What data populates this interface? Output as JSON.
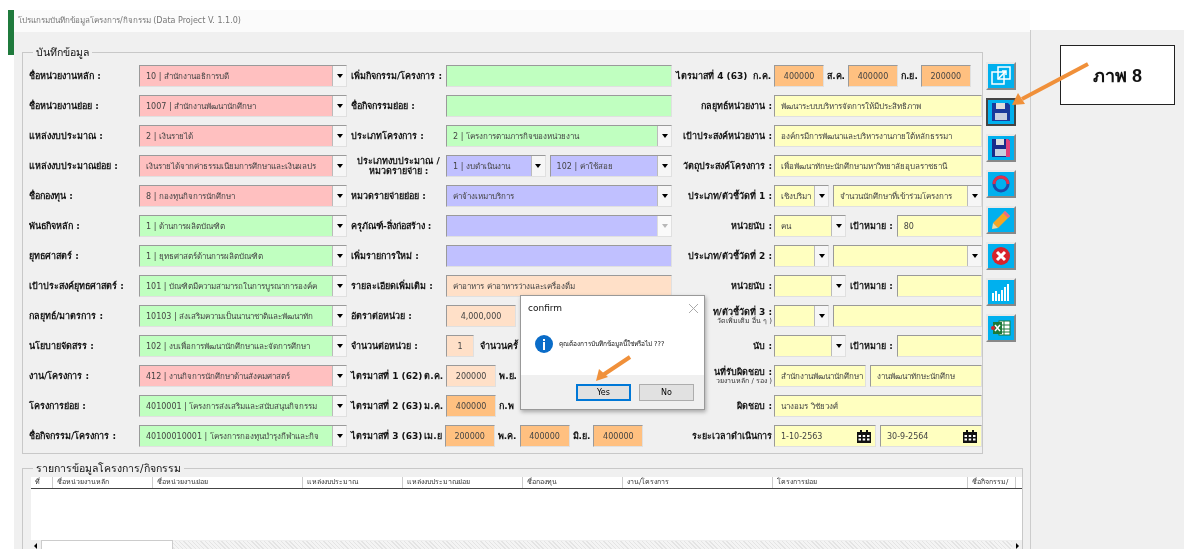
{
  "window": {
    "title": "โปรแกรมบันทึกข้อมูลโครงการ/กิจกรรม (Data Project V. 1.1.0)"
  },
  "form": {
    "title": "บันทึกข้อมูล",
    "columns": [
      {
        "rows": [
          {
            "kind": "wide",
            "label": "ชื่อหน่วยงานหลัก :",
            "fields": [
              {
                "kind": "select",
                "value": "10 | สำนักงานอธิการบดี",
                "color": "#ffc0c0",
                "disabled": false
              }
            ]
          },
          {
            "kind": "wide",
            "label": "ชื่อหน่วยงานย่อย :",
            "fields": [
              {
                "kind": "select",
                "value": "1007 | สำนักงานพัฒนานักศึกษา",
                "color": "#ffc0c0",
                "disabled": false
              }
            ]
          },
          {
            "kind": "wide",
            "label": "แหล่งงบประมาณ :",
            "fields": [
              {
                "kind": "select",
                "value": "2 | เงินรายได้",
                "color": "#ffc0c0",
                "disabled": false
              }
            ]
          },
          {
            "kind": "wide",
            "label": "แหล่งงบประมาณย่อย :",
            "fields": [
              {
                "kind": "select",
                "value": "เงินรายได้จากค่าธรรมเนียมการศึกษาและเงินผลปร",
                "color": "#ffc0c0",
                "disabled": false
              }
            ]
          },
          {
            "kind": "wide",
            "label": "ชื่อกองทุน :",
            "fields": [
              {
                "kind": "select",
                "value": "8 | กองทุนกิจการนักศึกษา",
                "color": "#ffc0c0",
                "disabled": false
              }
            ]
          },
          {
            "kind": "wide",
            "label": "พันธกิจหลัก :",
            "fields": [
              {
                "kind": "select",
                "value": "1 | ด้านการผลิตบัณฑิต",
                "color": "#c0ffc0",
                "disabled": false
              }
            ]
          },
          {
            "kind": "wide",
            "label": "ยุทธศาสตร์ :",
            "fields": [
              {
                "kind": "select",
                "value": "1 | ยุทธศาสตร์ด้านการผลิตบัณฑิต",
                "color": "#c0ffc0",
                "disabled": false
              }
            ]
          },
          {
            "kind": "wide",
            "label": "เป้าประสงค์ยุทธศาสตร์ :",
            "fields": [
              {
                "kind": "select",
                "value": "101 | บัณฑิตมีความสามารถในการบูรณาการองค์ค",
                "color": "#c0ffc0",
                "disabled": false
              }
            ]
          },
          {
            "kind": "wide",
            "label": "กลยุทธ์/มาตรการ :",
            "fields": [
              {
                "kind": "select",
                "value": "10103 | ส่งเสริมความเป็นนานาชาติและพัฒนาทัก",
                "color": "#c0ffc0",
                "disabled": false
              }
            ]
          },
          {
            "kind": "wide",
            "label": "นโยบายจัดสรร :",
            "fields": [
              {
                "kind": "select",
                "value": "102 | งบเพื่อการพัฒนานักศึกษาและจัดการศึกษา",
                "color": "#c0ffc0",
                "disabled": false
              }
            ]
          },
          {
            "kind": "wide",
            "label": "งาน/โครงการ :",
            "fields": [
              {
                "kind": "select",
                "value": "412 | งานกิจการนักศึกษาด้านสังคมศาสตร์",
                "color": "#ffc0c0",
                "disabled": false
              }
            ]
          },
          {
            "kind": "wide",
            "label": "โครงการย่อย :",
            "fields": [
              {
                "kind": "select",
                "value": "4010001 | โครงการส่งเสริมและสนับสนุนกิจกรรม",
                "color": "#c0ffc0",
                "disabled": false
              }
            ]
          },
          {
            "kind": "wide",
            "label": "ชื่อกิจกรรม/โครงการ :",
            "fields": [
              {
                "kind": "select",
                "value": "40100010001 | โครงการกองทุนบำรุงกีฬาและกิจ",
                "color": "#c0ffc0",
                "disabled": false
              }
            ]
          }
        ]
      },
      {
        "rows": [
          {
            "kind": "wide",
            "label": "เพิ่มกิจกรรม/โครงการ :",
            "fields": [
              {
                "kind": "text",
                "color": "#c0ffc0"
              }
            ]
          },
          {
            "kind": "wide",
            "label": "ชื่อกิจกรรมย่อย :",
            "fields": [
              {
                "kind": "text",
                "color": "#c0ffc0"
              }
            ]
          },
          {
            "kind": "wide",
            "label": "ประเภทโครงการ :",
            "fields": [
              {
                "kind": "select",
                "value": "2 | โครงการตามภารกิจของหน่วยงาน",
                "color": "#c0ffc0",
                "disabled": false
              }
            ]
          },
          {
            "kind": "pair",
            "label": "ประเภทงบประมาณ / หมวดรายจ่าย :",
            "fields": [
              {
                "kind": "select",
                "value": "1 | งบดำเนินงาน",
                "color": "#c0c0ff",
                "disabled": false
              },
              {
                "kind": "select",
                "value": "102 | ค่าใช้สอย",
                "color": "#c0c0ff",
                "disabled": false
              }
            ]
          },
          {
            "kind": "wide",
            "label": "หมวดรายจ่ายย่อย :",
            "fields": [
              {
                "kind": "select",
                "value": "ค่าจ้างเหมาบริการ",
                "color": "#c0c0ff",
                "disabled": false
              }
            ]
          },
          {
            "kind": "wide",
            "label": "ครุภัณฑ์-สิ่งก่อสร้าง :",
            "fields": [
              {
                "kind": "select",
                "color": "#c0c0ff",
                "disabled": true
              }
            ]
          },
          {
            "kind": "wide",
            "label": "เพิ่มรายการใหม่ :",
            "fields": [
              {
                "kind": "text",
                "color": "#c0c0ff"
              }
            ]
          },
          {
            "kind": "wide",
            "label": "รายละเอียดเพิ่มเติม :",
            "fields": [
              {
                "kind": "text",
                "value": "ค่าอาหาร ค่าอาหารว่างและเครื่องดื่ม",
                "color": "#ffe0c8"
              }
            ]
          },
          {
            "kind": "short",
            "label": "อัตราต่อหน่วย :",
            "fields": [
              {
                "kind": "text",
                "value": "4,000,000",
                "color": "#ffe0c8"
              }
            ]
          },
          {
            "kind": "count",
            "label": "จำนวนต่อหน่วย :",
            "fields": [
              {
                "kind": "text",
                "value": "1",
                "color": "#ffe0c8"
              },
              {
                "kind": "caption",
                "text": "จำนวนครั้"
              }
            ]
          },
          {
            "kind": "quarter",
            "label": "ไตรมาสที่ 1 (62)",
            "fields": [
              {
                "kind": "caption",
                "text": "ต.ค."
              },
              {
                "kind": "text",
                "value": "200000",
                "color": "#ffe0c8"
              },
              {
                "kind": "caption",
                "text": "พ.ย."
              }
            ]
          },
          {
            "kind": "quarter",
            "label": "ไตรมาสที่ 2 (63)",
            "fields": [
              {
                "kind": "caption",
                "text": "ม.ค."
              },
              {
                "kind": "text",
                "value": "400000",
                "color": "#ffc080"
              },
              {
                "kind": "caption",
                "text": "ก.พ"
              }
            ]
          },
          {
            "kind": "quarter",
            "label": "ไตรมาสที่ 3 (63)",
            "fields": [
              {
                "kind": "caption",
                "text": "เม.ย"
              },
              {
                "kind": "text",
                "value": "200000",
                "color": "#ffc080"
              },
              {
                "kind": "caption",
                "text": "พ.ค."
              },
              {
                "kind": "text",
                "value": "400000",
                "color": "#ffc080"
              },
              {
                "kind": "caption",
                "text": "มิ.ย."
              },
              {
                "kind": "text",
                "value": "400000",
                "color": "#ffc080"
              }
            ]
          }
        ]
      },
      {
        "rows": [
          {
            "kind": "quarter",
            "label": "ไตรมาสที่ 4 (63)",
            "fields": [
              {
                "kind": "caption",
                "text": "ก.ค."
              },
              {
                "kind": "text",
                "value": "400000",
                "color": "#ffc080"
              },
              {
                "kind": "caption",
                "text": "ส.ค."
              },
              {
                "kind": "text",
                "value": "400000",
                "color": "#ffc080"
              },
              {
                "kind": "caption",
                "text": "ก.ย."
              },
              {
                "kind": "text",
                "value": "200000",
                "color": "#ffc080"
              }
            ]
          },
          {
            "kind": "wide",
            "label": "กลยุทธ์หน่วยงาน :",
            "fields": [
              {
                "kind": "text",
                "value": "พัฒนาระบบบริหารจัดการให้มีประสิทธิภาพ",
                "color": "#ffffc0"
              }
            ]
          },
          {
            "kind": "wide",
            "label": "เป้าประสงค์หน่วยงาน :",
            "fields": [
              {
                "kind": "text",
                "value": "องค์กรมีการพัฒนาและบริหารงานภายใต้หลักธรรมา",
                "color": "#ffffc0"
              }
            ]
          },
          {
            "kind": "wide",
            "label": "วัตถุประสงค์โครงการ :",
            "fields": [
              {
                "kind": "text",
                "value": "เพื่อพัฒนาทักษะนักศึกษามหาวิทยาลัยอุบลราชธานี",
                "color": "#ffffc0"
              }
            ]
          },
          {
            "kind": "indicator",
            "label": "ประเภท/ตัวชี้วัดที่ 1 :",
            "fields": [
              {
                "kind": "select",
                "value": "เชิงปริมา",
                "color": "#ffffc0",
                "disabled": false
              },
              {
                "kind": "select",
                "value": "จำนวนนักศึกษาที่เข้าร่วมโครงการ",
                "color": "#ffffc0",
                "disabled": false
              }
            ]
          },
          {
            "kind": "unit",
            "label": "หน่วยนับ :",
            "fields": [
              {
                "kind": "select",
                "value": "คน",
                "color": "#ffffc0",
                "disabled": false
              },
              {
                "kind": "caption",
                "text": "เป้าหมาย :"
              },
              {
                "kind": "text",
                "value": "80",
                "color": "#ffffc0"
              }
            ]
          },
          {
            "kind": "indicator",
            "label": "ประเภท/ตัวชี้วัดที่ 2 :",
            "fields": [
              {
                "kind": "select",
                "color": "#ffffc0",
                "disabled": false
              },
              {
                "kind": "select",
                "color": "#ffffc0",
                "disabled": false
              }
            ]
          },
          {
            "kind": "unit",
            "label": "หน่วยนับ :",
            "fields": [
              {
                "kind": "select",
                "color": "#ffffc0",
                "disabled": false
              },
              {
                "kind": "caption",
                "text": "เป้าหมาย :"
              },
              {
                "kind": "text",
                "color": "#ffffc0"
              }
            ]
          },
          {
            "kind": "indicator",
            "label": "ท/ตัวชี้วัดที่ 3 :",
            "note": "วัดเพิ่มเติม อื่น ๆ )",
            "fields": [
              {
                "kind": "select",
                "color": "#ffffc0",
                "disabled": false
              },
              {
                "kind": "text",
                "color": "#ffffc0"
              }
            ]
          },
          {
            "kind": "unit",
            "label": "นับ :",
            "fields": [
              {
                "kind": "select",
                "color": "#ffffc0",
                "disabled": false
              },
              {
                "kind": "caption",
                "text": "เป้าหมาย :"
              },
              {
                "kind": "text",
                "color": "#ffffc0"
              }
            ]
          },
          {
            "kind": "pair",
            "label": "นที่รับผิดชอบ :",
            "note": "วยงานหลัก / รอง )",
            "fields": [
              {
                "kind": "text",
                "value": "สำนักงานพัฒนานักศึกษา",
                "color": "#ffffc0"
              },
              {
                "kind": "text",
                "value": "งานพัฒนาทักษะนักศึกษ",
                "color": "#ffffc0"
              }
            ]
          },
          {
            "kind": "wide",
            "label": "ผิดชอบ :",
            "fields": [
              {
                "kind": "text",
                "value": "นางอมร วิชัยวงศ์",
                "color": "#ffffc0"
              }
            ]
          },
          {
            "kind": "dates",
            "label": "ระยะเวลาดำเนินการ",
            "fields": [
              {
                "kind": "date",
                "value": "1-10-2563",
                "color": "#ffffc0"
              },
              {
                "kind": "date",
                "value": "30-9-2564",
                "color": "#ffffc0"
              }
            ]
          }
        ]
      }
    ]
  },
  "toolbar": [
    {
      "kind": "expand",
      "selected": false
    },
    {
      "kind": "save",
      "selected": true
    },
    {
      "kind": "save_as",
      "selected": false
    },
    {
      "kind": "refresh",
      "selected": false
    },
    {
      "kind": "edit",
      "selected": false
    },
    {
      "kind": "delete",
      "selected": false
    },
    {
      "kind": "chart",
      "selected": false
    },
    {
      "kind": "excel",
      "selected": false
    }
  ],
  "records": {
    "title": "รายการข้อมูลโครงการ/กิจกรรม",
    "columns": [
      "ที่",
      "ชื่อหน่วยงานหลัก",
      "ชื่อหน่วยงานย่อย",
      "แหล่งงบประมาณ",
      "แหล่งงบประมาณย่อย",
      "ชื่อกองทุน",
      "งาน/โครงการ",
      "โครงการย่อย",
      "ชื่อกิจกรรม/"
    ]
  },
  "dialog": {
    "title": "confirm",
    "message": "คุณต้องการบันทึกข้อมูลนี้ใช่หรือไม่ ???",
    "buttons": [
      {
        "label": "Yes",
        "selected": true
      },
      {
        "label": "No",
        "selected": false
      }
    ]
  },
  "caption": "ภาพ 8"
}
